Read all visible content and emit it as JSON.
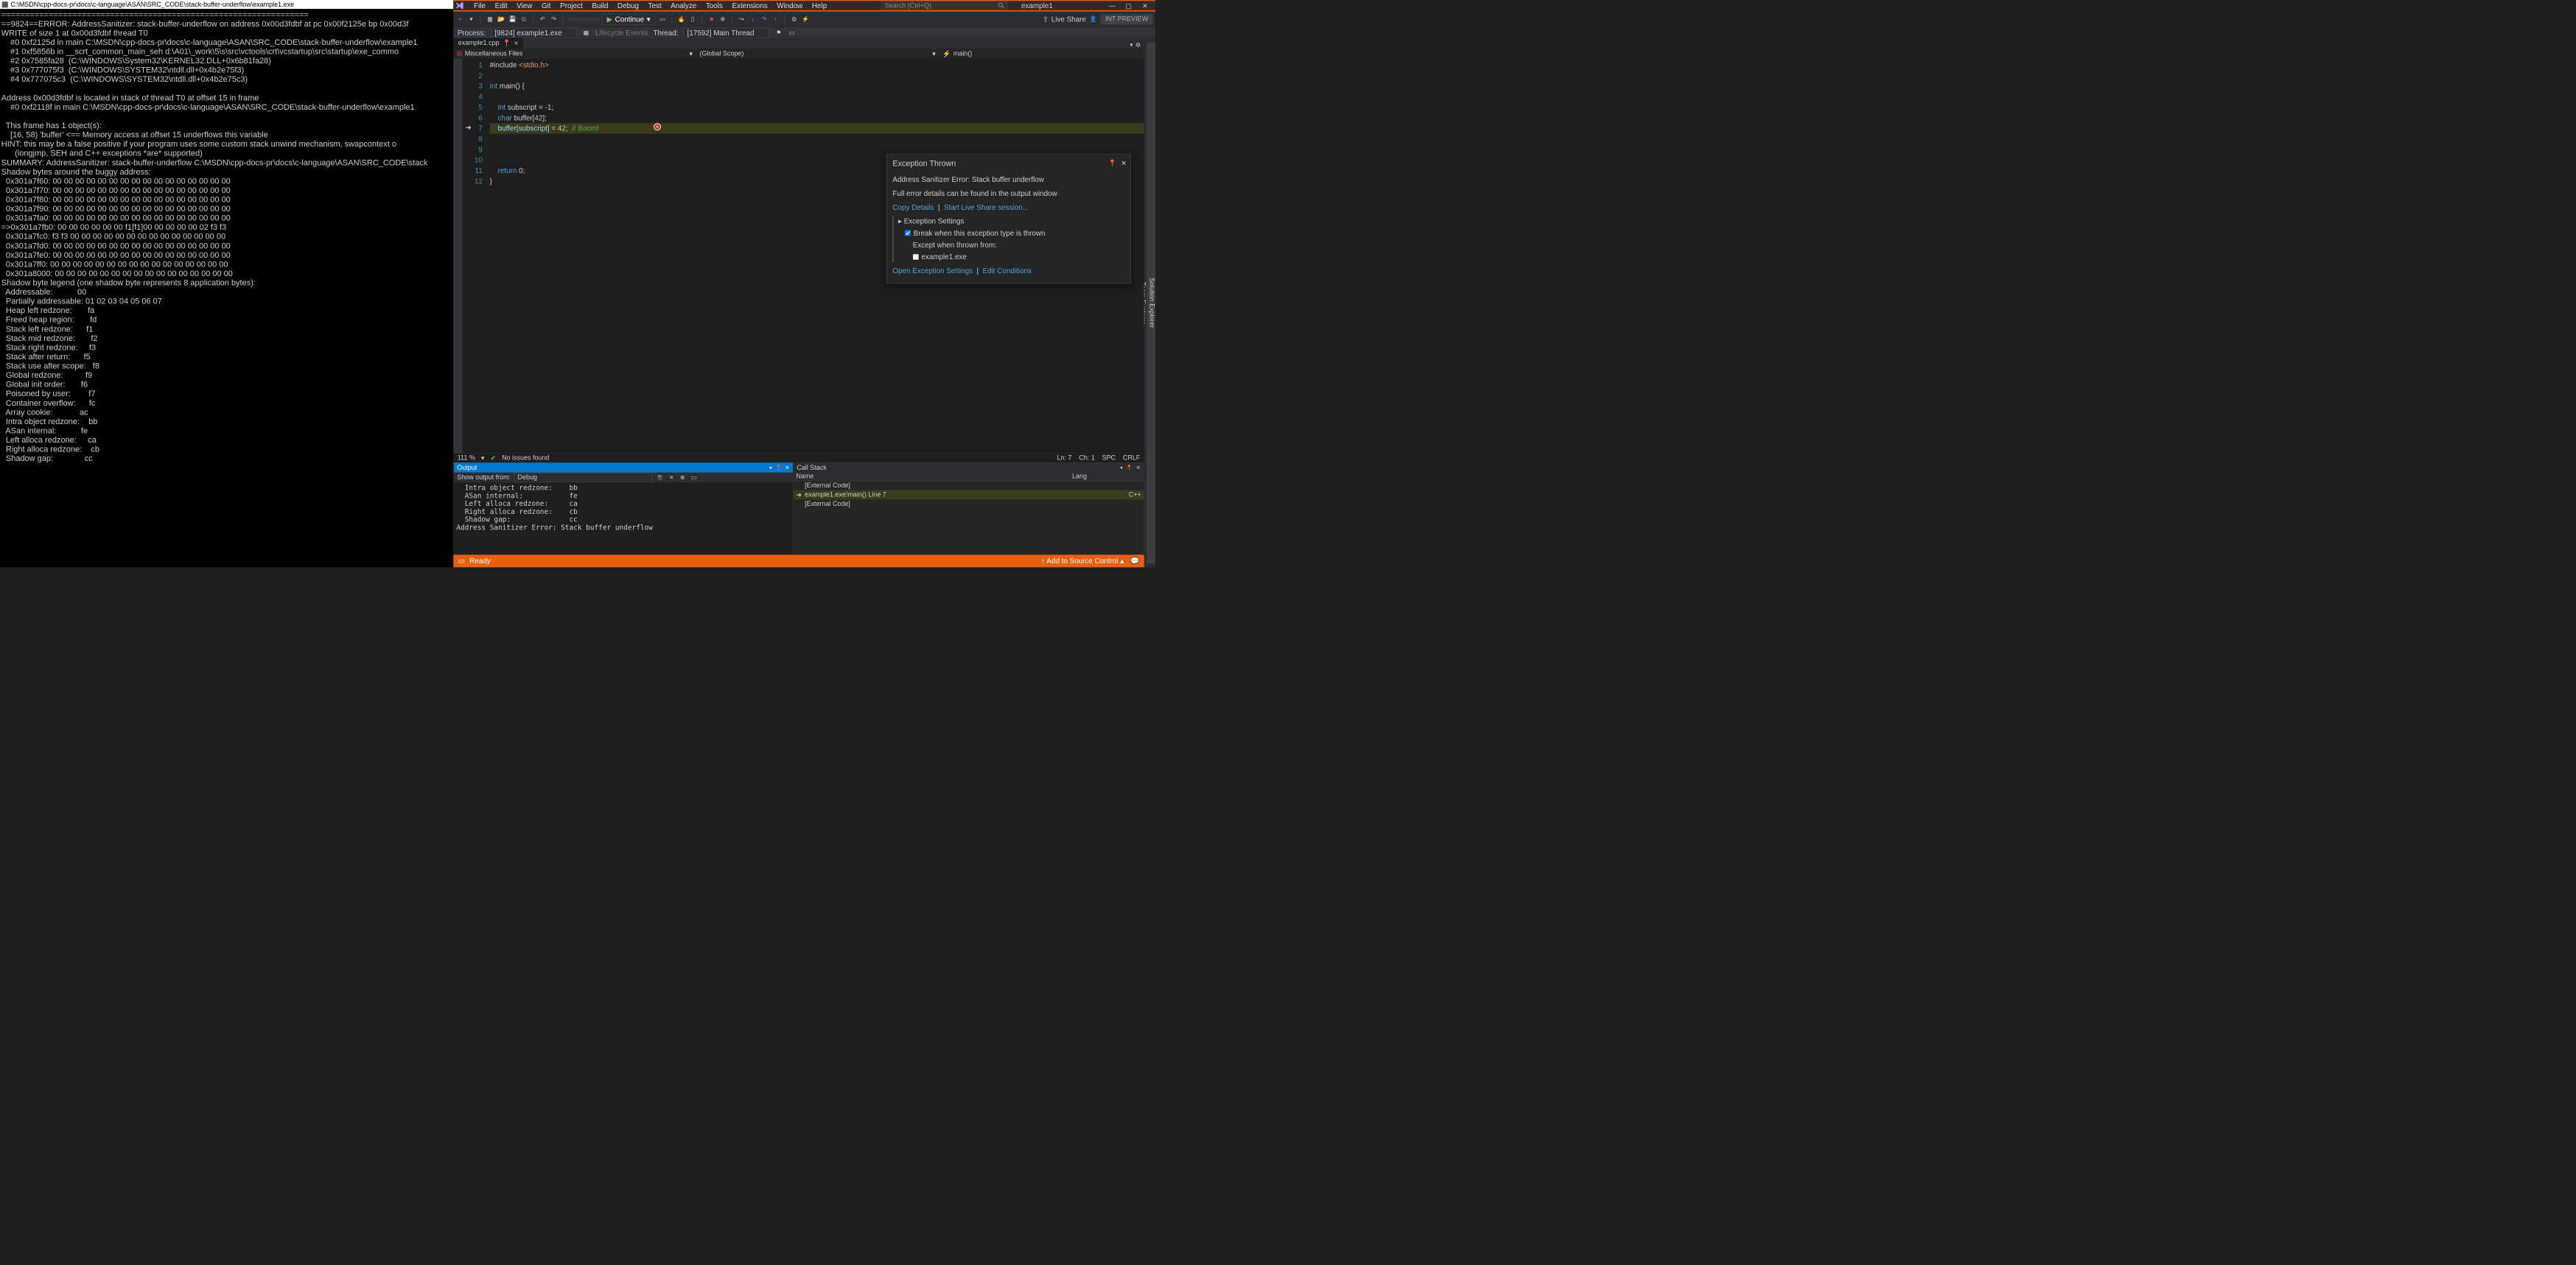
{
  "console": {
    "title": "C:\\MSDN\\cpp-docs-pr\\docs\\c-language\\ASAN\\SRC_CODE\\stack-buffer-underflow\\example1.exe",
    "body": "=================================================================\n==9824==ERROR: AddressSanitizer: stack-buffer-underflow on address 0x00d3fdbf at pc 0x00f2125e bp 0x00d3f\nWRITE of size 1 at 0x00d3fdbf thread T0\n    #0 0xf2125d in main C:\\MSDN\\cpp-docs-pr\\docs\\c-language\\ASAN\\SRC_CODE\\stack-buffer-underflow\\example1\n    #1 0xf5856b in __scrt_common_main_seh d:\\A01\\_work\\5\\s\\src\\vctools\\crt\\vcstartup\\src\\startup\\exe_commo\n    #2 0x7585fa28  (C:\\WINDOWS\\System32\\KERNEL32.DLL+0x6b81fa28)\n    #3 0x777075f3  (C:\\WINDOWS\\SYSTEM32\\ntdll.dll+0x4b2e75f3)\n    #4 0x777075c3  (C:\\WINDOWS\\SYSTEM32\\ntdll.dll+0x4b2e75c3)\n\nAddress 0x00d3fdbf is located in stack of thread T0 at offset 15 in frame\n    #0 0xf2118f in main C:\\MSDN\\cpp-docs-pr\\docs\\c-language\\ASAN\\SRC_CODE\\stack-buffer-underflow\\example1\n\n  This frame has 1 object(s):\n    [16, 58) 'buffer' <== Memory access at offset 15 underflows this variable\nHINT: this may be a false positive if your program uses some custom stack unwind mechanism, swapcontext o\n      (longjmp, SEH and C++ exceptions *are* supported)\nSUMMARY: AddressSanitizer: stack-buffer-underflow C:\\MSDN\\cpp-docs-pr\\docs\\c-language\\ASAN\\SRC_CODE\\stack\nShadow bytes around the buggy address:\n  0x301a7f60: 00 00 00 00 00 00 00 00 00 00 00 00 00 00 00 00\n  0x301a7f70: 00 00 00 00 00 00 00 00 00 00 00 00 00 00 00 00\n  0x301a7f80: 00 00 00 00 00 00 00 00 00 00 00 00 00 00 00 00\n  0x301a7f90: 00 00 00 00 00 00 00 00 00 00 00 00 00 00 00 00\n  0x301a7fa0: 00 00 00 00 00 00 00 00 00 00 00 00 00 00 00 00\n=>0x301a7fb0: 00 00 00 00 00 00 f1[f1]00 00 00 00 00 02 f3 f3\n  0x301a7fc0: f3 f3 00 00 00 00 00 00 00 00 00 00 00 00 00 00\n  0x301a7fd0: 00 00 00 00 00 00 00 00 00 00 00 00 00 00 00 00\n  0x301a7fe0: 00 00 00 00 00 00 00 00 00 00 00 00 00 00 00 00\n  0x301a7ff0: 00 00 00 00 00 00 00 00 00 00 00 00 00 00 00 00\n  0x301a8000: 00 00 00 00 00 00 00 00 00 00 00 00 00 00 00 00\nShadow byte legend (one shadow byte represents 8 application bytes):\n  Addressable:           00\n  Partially addressable: 01 02 03 04 05 06 07\n  Heap left redzone:       fa\n  Freed heap region:       fd\n  Stack left redzone:      f1\n  Stack mid redzone:       f2\n  Stack right redzone:     f3\n  Stack after return:      f5\n  Stack use after scope:   f8\n  Global redzone:          f9\n  Global init order:       f6\n  Poisoned by user:        f7\n  Container overflow:      fc\n  Array cookie:            ac\n  Intra object redzone:    bb\n  ASan internal:           fe\n  Left alloca redzone:     ca\n  Right alloca redzone:    cb\n  Shadow gap:              cc"
  },
  "menus": [
    "File",
    "Edit",
    "View",
    "Git",
    "Project",
    "Build",
    "Debug",
    "Test",
    "Analyze",
    "Tools",
    "Extensions",
    "Window",
    "Help"
  ],
  "search_placeholder": "Search (Ctrl+Q)",
  "solution_name": "example1",
  "continue_label": "Continue",
  "live_share": "Live Share",
  "int_preview": "INT PREVIEW",
  "process_label": "Process:",
  "process_value": "[9824] example1.exe",
  "lifecycle": "Lifecycle Events",
  "thread_label": "Thread:",
  "thread_value": "[17592] Main Thread",
  "side_tabs": [
    "Solution Explorer",
    "Team Explorer"
  ],
  "doc_tab": "example1.cpp",
  "nav1": "Miscellaneous Files",
  "nav2": "(Global Scope)",
  "nav3": "main()",
  "code_lines": {
    "l1_a": "#include ",
    "l1_b": "<stdio.h>",
    "l3_a": "int",
    "l3_b": " main",
    "l3_c": "() {",
    "l5_a": "int",
    "l5_b": " subscript = ",
    "l5_c": "-1",
    "l5_d": ";",
    "l6_a": "char",
    "l6_b": " buffer[",
    "l6_c": "42",
    "l6_d": "];",
    "l7_a": "buffer",
    "l7_b": "[",
    "l7_c": "subscript",
    "l7_d": "] = ",
    "l7_e": "42",
    "l7_f": ";  ",
    "l7_g": "// Boom!",
    "l9_a": "return",
    "l9_b": " 0",
    "l9_c": ";",
    "l10": "}"
  },
  "exc": {
    "title": "Exception Thrown",
    "msg": "Address Sanitizer Error: Stack buffer underflow",
    "sub": "Full error details can be found in the output window",
    "copy": "Copy Details",
    "start": "Start Live Share session...",
    "settings": "Exception Settings",
    "break": "Break when this exception type is thrown",
    "except": "Except when thrown from:",
    "module": "example1.exe",
    "open": "Open Exception Settings",
    "edit": "Edit Conditions"
  },
  "status_strip": {
    "zoom": "111 %",
    "issues": "No issues found",
    "ln": "Ln: 7",
    "ch": "Ch: 1",
    "spc": "SPC",
    "crlf": "CRLF"
  },
  "output": {
    "title": "Output",
    "show": "Show output from:",
    "source": "Debug",
    "body": "  Intra object redzone:    bb\n  ASan internal:           fe\n  Left alloca redzone:     ca\n  Right alloca redzone:    cb\n  Shadow gap:              cc\nAddress Sanitizer Error: Stack buffer underflow"
  },
  "callstack": {
    "title": "Call Stack",
    "cols": [
      "Name",
      "Lang"
    ],
    "rows": [
      {
        "name": "[External Code]",
        "lang": ""
      },
      {
        "name": "example1.exe!main() Line 7",
        "lang": "C++",
        "cur": true
      },
      {
        "name": "[External Code]",
        "lang": ""
      }
    ]
  },
  "status_bar": {
    "ready": "Ready",
    "add": "Add to Source Control"
  }
}
